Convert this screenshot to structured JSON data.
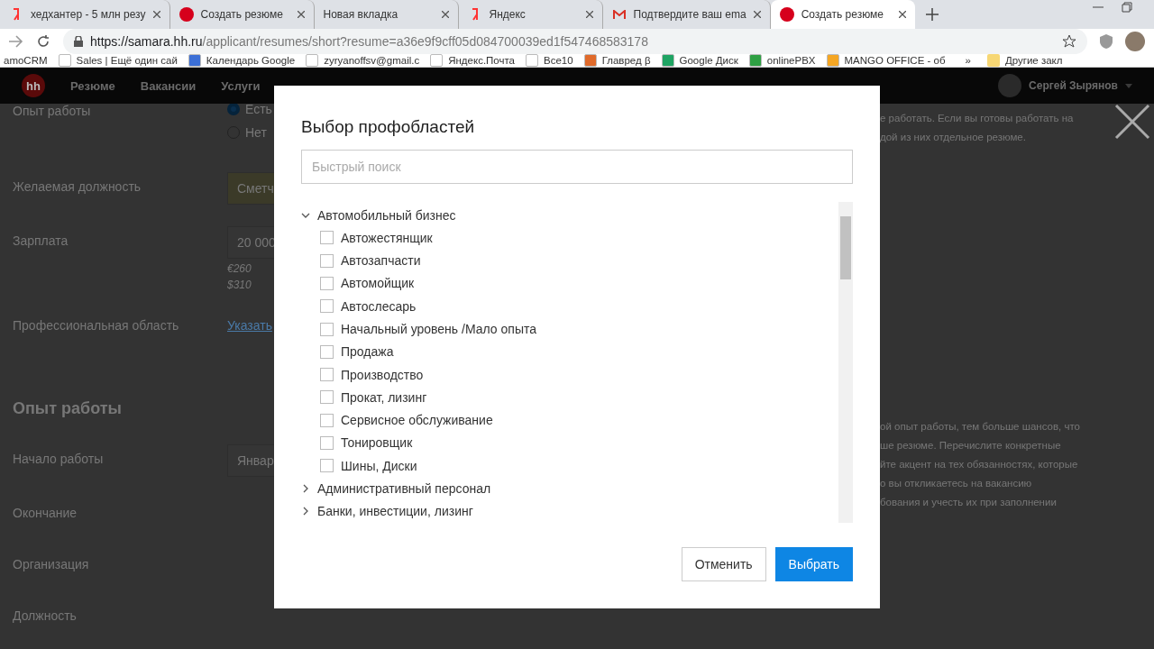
{
  "tabs": [
    {
      "title": "хедхантер - 5 млн резу",
      "selected": false
    },
    {
      "title": "Создать резюме",
      "selected": false
    },
    {
      "title": "Новая вкладка",
      "selected": false
    },
    {
      "title": "Яндекс",
      "selected": false
    },
    {
      "title": "Подтвердите ваш ema",
      "selected": false
    },
    {
      "title": "Создать резюме",
      "selected": true
    }
  ],
  "address": {
    "host": "https://samara.hh.ru",
    "path": "/applicant/resumes/short?resume=a36e9f9cff05d084700039ed1f547468583178"
  },
  "bookmarks": [
    "amoCRM",
    "Sales | Ещё один сай",
    "Календарь Google",
    "zyryanoffsv@gmail.c",
    "Яндекс.Почта",
    "Все10",
    "Главред β",
    "Google Диск",
    "onlinePBX",
    "MANGO OFFICE - об"
  ],
  "bookmarks_more": "»",
  "bookmarks_folder": "Другие закл",
  "site_header": {
    "logo": "hh",
    "nav": [
      "Резюме",
      "Вакансии",
      "Услуги"
    ],
    "user": "Сергей Зырянов"
  },
  "form_rows": [
    {
      "label": "Опыт работы",
      "kind": "radio",
      "options": [
        {
          "label": "Есть",
          "selected": true
        },
        {
          "label": "Нет",
          "selected": false
        }
      ]
    },
    {
      "label": "Желаемая должность",
      "kind": "field",
      "value": "Сметч",
      "highlighted": true
    },
    {
      "label": "Зарплата",
      "kind": "field",
      "value": "20 000",
      "notes": [
        "€260",
        "$310"
      ],
      "highlighted": false
    },
    {
      "label": "Профессиональная область",
      "kind": "link",
      "value": "Указать"
    },
    {
      "label": "Опыт работы",
      "kind": "heading"
    },
    {
      "label": "Начало работы",
      "kind": "field",
      "value": "Январ",
      "highlighted": false
    },
    {
      "label": "Окончание",
      "kind": "empty"
    },
    {
      "label": "Организация",
      "kind": "empty"
    },
    {
      "label": "Должность",
      "kind": "empty"
    }
  ],
  "side_texts": [
    [
      "е работать. Если вы готовы работать на",
      "дой из них отдельное резюме."
    ],
    [
      "ой опыт работы, тем больше шансов, что",
      "ше резюме. Перечислите конкретные",
      "йте акцент на тех обязанностях, которые",
      "о вы откликаетесь на вакансию",
      "бования и учесть их при заполнении"
    ]
  ],
  "dialog": {
    "title": "Выбор профобластей",
    "search": {
      "placeholder": "Быстрый поиск"
    },
    "tree": [
      {
        "label": "Автомобильный бизнес",
        "expanded": true,
        "children": [
          {
            "label": "Автожестянщик",
            "checked": false
          },
          {
            "label": "Автозапчасти",
            "checked": false
          },
          {
            "label": "Автомойщик",
            "checked": false
          },
          {
            "label": "Автослесарь",
            "checked": false
          },
          {
            "label": "Начальный уровень /Мало опыта",
            "checked": false
          },
          {
            "label": "Продажа",
            "checked": false
          },
          {
            "label": "Производство",
            "checked": false
          },
          {
            "label": "Прокат, лизинг",
            "checked": false
          },
          {
            "label": "Сервисное обслуживание",
            "checked": false
          },
          {
            "label": "Тонировщик",
            "checked": false
          },
          {
            "label": "Шины, Диски",
            "checked": false
          }
        ]
      },
      {
        "label": "Административный персонал",
        "expanded": false
      },
      {
        "label": "Банки, инвестиции, лизинг",
        "expanded": false
      }
    ],
    "buttons": [
      {
        "label": "Отменить",
        "primary": false
      },
      {
        "label": "Выбрать",
        "primary": true
      }
    ]
  }
}
